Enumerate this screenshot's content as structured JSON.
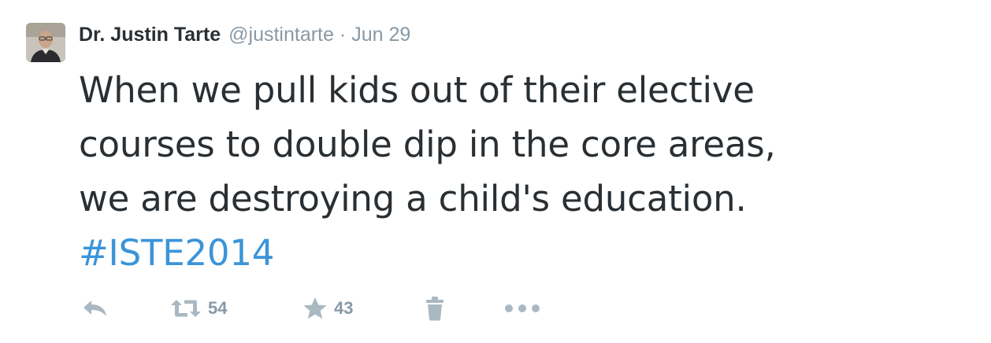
{
  "tweet": {
    "author": {
      "name": "Dr. Justin Tarte",
      "handle": "@justintarte"
    },
    "separator": "·",
    "date": "Jun 29",
    "text_lines": [
      "When we pull kids out of their elective",
      "courses to double dip in the core areas,",
      "we are destroying a child's education."
    ],
    "hashtag": "#ISTE2014",
    "actions": {
      "retweet_count": "54",
      "favorite_count": "43"
    }
  },
  "colors": {
    "text": "#292f33",
    "muted": "#8899a6",
    "link": "#3b94d9",
    "icon": "#aab8c2"
  },
  "icons": {
    "reply": "reply-icon",
    "retweet": "retweet-icon",
    "favorite": "star-icon",
    "delete": "trash-icon",
    "more": "ellipsis-icon"
  }
}
